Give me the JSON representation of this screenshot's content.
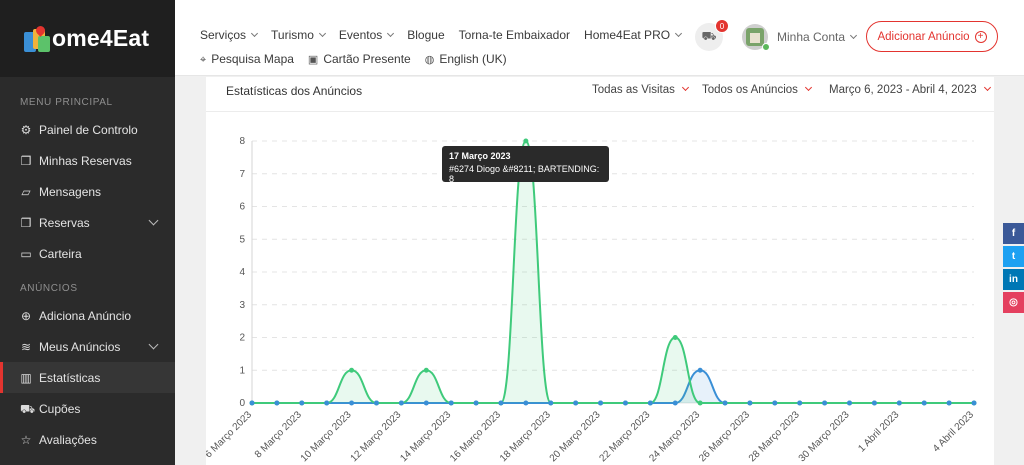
{
  "brand": {
    "logo_text": "ome4Eat"
  },
  "sidebar": {
    "section_main": "MENU PRINCIPAL",
    "main_items": [
      {
        "label": "Painel de Controlo",
        "icon": "gear-icon"
      },
      {
        "label": "Minhas Reservas",
        "icon": "bookmark-icon"
      },
      {
        "label": "Mensagens",
        "icon": "chat-icon"
      },
      {
        "label": "Reservas",
        "icon": "bookmark-icon"
      },
      {
        "label": "Carteira",
        "icon": "wallet-icon"
      }
    ],
    "section_listings": "ANÚNCIOS",
    "listing_items": [
      {
        "label": "Adiciona Anúncio",
        "icon": "plus-circle-icon"
      },
      {
        "label": "Meus Anúncios",
        "icon": "layers-icon"
      },
      {
        "label": "Estatísticas",
        "icon": "bar-chart-icon"
      },
      {
        "label": "Cupões",
        "icon": "cart-icon"
      },
      {
        "label": "Avaliações",
        "icon": "star-icon"
      }
    ]
  },
  "header": {
    "nav": [
      "Serviços",
      "Turismo",
      "Eventos",
      "Blogue",
      "Torna-te Embaixador",
      "Home4Eat PRO"
    ],
    "nav2": [
      "Pesquisa Mapa",
      "Cartão Presente",
      "English (UK)"
    ],
    "cart_count": "0",
    "account_label": "Minha Conta",
    "add_listing_label": "Adicionar Anúncio"
  },
  "card": {
    "title": "Estatísticas dos Anúncios",
    "filter_visits": "Todas as Visitas",
    "filter_listings": "Todos os Anúncios",
    "filter_dates": "Março 6, 2023 - Abril 4, 2023"
  },
  "tooltip": {
    "title": "17 Março 2023",
    "body": "#6274 Diogo &#8211; BARTENDING: 8"
  },
  "colors": {
    "accent": "#e3342f",
    "series_green": "#3fca7b",
    "series_blue": "#3a8fd6"
  },
  "chart_data": {
    "type": "line",
    "x": [
      "6 Março 2023",
      "7 Março 2023",
      "8 Março 2023",
      "9 Março 2023",
      "10 Março 2023",
      "11 Março 2023",
      "12 Março 2023",
      "13 Março 2023",
      "14 Março 2023",
      "15 Março 2023",
      "16 Março 2023",
      "17 Março 2023",
      "18 Março 2023",
      "19 Março 2023",
      "20 Março 2023",
      "21 Março 2023",
      "22 Março 2023",
      "23 Março 2023",
      "24 Março 2023",
      "25 Março 2023",
      "26 Março 2023",
      "27 Março 2023",
      "28 Março 2023",
      "29 Março 2023",
      "30 Março 2023",
      "31 Março 2023",
      "1 Abril 2023",
      "2 Abril 2023",
      "3 Abril 2023",
      "4 Abril 2023"
    ],
    "tick_labels": [
      "6 Março 2023",
      "8 Março 2023",
      "10 Março 2023",
      "12 Março 2023",
      "14 Março 2023",
      "16 Março 2023",
      "18 Março 2023",
      "20 Março 2023",
      "22 Março 2023",
      "24 Março 2023",
      "26 Março 2023",
      "28 Março 2023",
      "30 Março 2023",
      "1 Abril 2023",
      "4 Abril 2023"
    ],
    "series": [
      {
        "name": "#6274 Diogo &#8211; BARTENDING",
        "color": "#3fca7b",
        "values": [
          0,
          0,
          0,
          0,
          1,
          0,
          0,
          1,
          0,
          0,
          0,
          8,
          0,
          0,
          0,
          0,
          0,
          2,
          0,
          0,
          0,
          0,
          0,
          0,
          0,
          0,
          0,
          0,
          0,
          0
        ]
      },
      {
        "color": "#3a8fd6",
        "values": [
          0,
          0,
          0,
          0,
          0,
          0,
          0,
          0,
          0,
          0,
          0,
          0,
          0,
          0,
          0,
          0,
          0,
          0,
          1,
          0,
          0,
          0,
          0,
          0,
          0,
          0,
          0,
          0,
          0,
          0
        ]
      }
    ],
    "ylim": [
      0,
      8
    ],
    "yticks": [
      0,
      1,
      2,
      3,
      4,
      5,
      6,
      7,
      8
    ],
    "grid": true
  },
  "social": [
    {
      "icon": "facebook-icon",
      "glyph": "f",
      "color": "#3b5998"
    },
    {
      "icon": "twitter-icon",
      "glyph": "t",
      "color": "#1da1f2"
    },
    {
      "icon": "linkedin-icon",
      "glyph": "in",
      "color": "#0077b5"
    },
    {
      "icon": "instagram-icon",
      "glyph": "◎",
      "color": "#e4405f"
    }
  ]
}
